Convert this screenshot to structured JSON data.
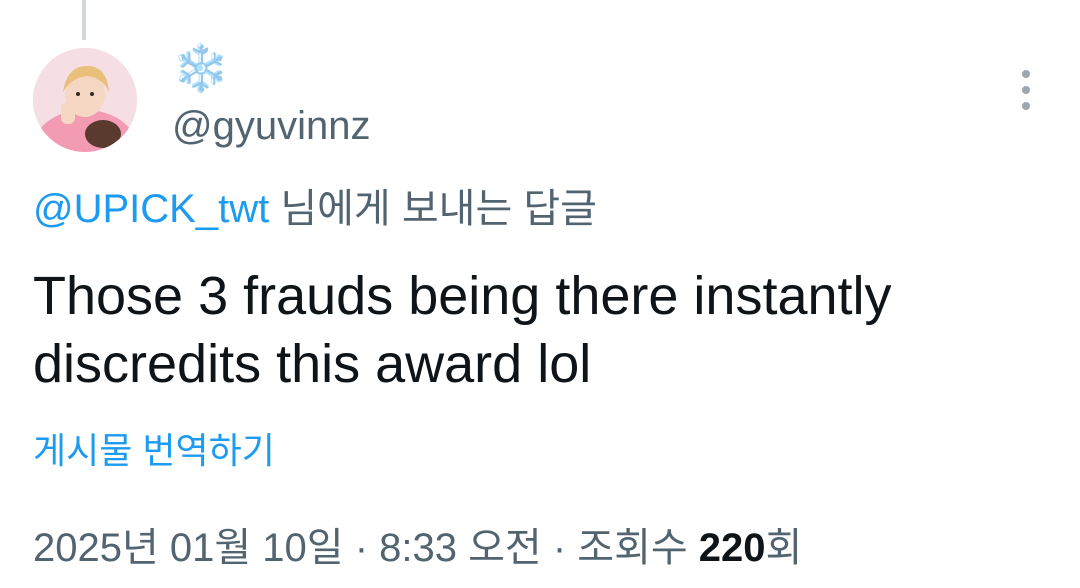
{
  "tweet": {
    "display_name": "❄️",
    "handle": "@gyuvinnz",
    "reply_to_mention": "@UPICK_twt",
    "reply_to_suffix": " 님에게 보내는 답글",
    "text": "Those 3 frauds being there instantly discredits this award lol",
    "translate_label": "게시물 번역하기",
    "date": "2025년 01월 10일",
    "separator": " · ",
    "time": "8:33 오전",
    "views_label": "조회수 ",
    "views_count": "220",
    "views_suffix": "회"
  },
  "icons": {
    "more": "more-vertical-icon",
    "avatar": "profile-photo"
  },
  "colors": {
    "link": "#1d9bf0",
    "secondary_text": "#536471",
    "primary_text": "#0f1419",
    "thread_line": "#cfd9de"
  }
}
